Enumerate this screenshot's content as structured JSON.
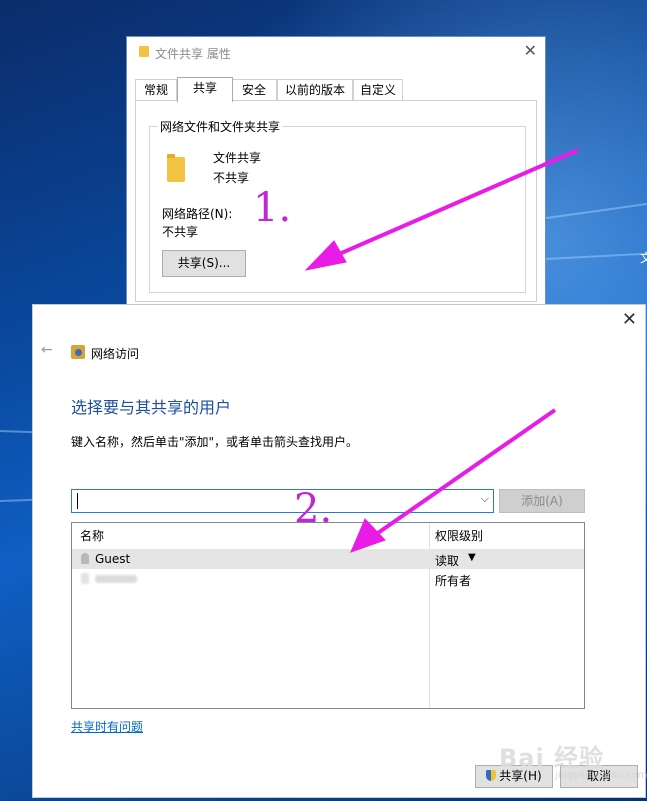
{
  "properties_window": {
    "title": "文件共享 属性",
    "close_glyph": "✕",
    "tabs": [
      {
        "label": "常规",
        "active": false
      },
      {
        "label": "共享",
        "active": true
      },
      {
        "label": "安全",
        "active": false
      },
      {
        "label": "以前的版本",
        "active": false
      },
      {
        "label": "自定义",
        "active": false
      }
    ],
    "group_label": "网络文件和文件夹共享",
    "folder_name": "文件共享",
    "folder_status": "不共享",
    "network_path_label": "网络路径(N):",
    "network_path_value": "不共享",
    "share_button": "共享(S)..."
  },
  "annotations": {
    "step1": "1.",
    "step2": "2.",
    "arrow_color": "#e81ce6"
  },
  "desktop_edge_text": "文",
  "network_access_dialog": {
    "close_glyph": "✕",
    "back_glyph": "←",
    "breadcrumb": "网络访问",
    "heading": "选择要与其共享的用户",
    "instruction": "键入名称，然后单击\"添加\"，或者单击箭头查找用户。",
    "user_input_value": "",
    "dropdown_glyph": "⌵",
    "add_button": "添加(A)",
    "table": {
      "columns": [
        "名称",
        "权限级别"
      ],
      "rows": [
        {
          "name": "Guest",
          "permission": "读取",
          "has_dropdown": true,
          "selected": true
        },
        {
          "name": "",
          "permission": "所有者",
          "has_dropdown": false,
          "selected": false
        }
      ]
    },
    "help_link": "共享时有问题",
    "share_button": "共享(H)",
    "cancel_button": "取消"
  },
  "watermark": {
    "brand": "Bai 经验",
    "url": "jingyan.baidu.com"
  },
  "colors": {
    "accent": "#1d4fa0",
    "link": "#0066cc",
    "combo_border": "#2a7ad5"
  }
}
